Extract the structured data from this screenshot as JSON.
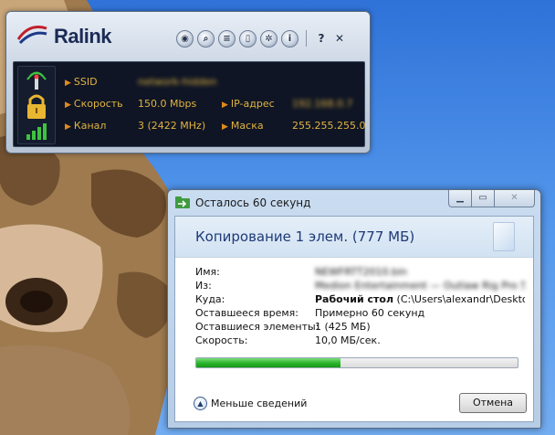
{
  "ralink": {
    "logo_text": "Ralink",
    "toolbar": {
      "icons": [
        "rss-icon",
        "search-icon",
        "list-icon",
        "page-icon",
        "gear-icon",
        "info-icon"
      ],
      "help_label": "?",
      "close_label": "✕"
    },
    "ssid_label": "SSID",
    "ssid_value": "network-hidden",
    "speed_label": "Скорость",
    "speed_value": "150.0 Mbps",
    "channel_label": "Канал",
    "channel_value": "3 (2422 MHz)",
    "ip_label": "IP-адрес",
    "ip_value": "192.168.0.7",
    "mask_label": "Маска",
    "mask_value": "255.255.255.0"
  },
  "copy_dialog": {
    "title": "Осталось 60 секунд",
    "header": "Копирование 1 элем. (777 МБ)",
    "labels": {
      "name": "Имя:",
      "from": "Из:",
      "to": "Куда:",
      "time_left": "Оставшееся время:",
      "items_left": "Оставшиеся элементы:",
      "speed": "Скорость:"
    },
    "values": {
      "name": "NEWFRTT2010.bin",
      "from": "Medion Entertainment — Outlaw Rig Pro 5.12",
      "to_bold": "Рабочий стол",
      "to_path": "(C:\\Users\\alexandr\\Desktop",
      "time_left": "Примерно 60 секунд",
      "items_left": "1 (425 МБ)",
      "speed": "10,0 МБ/сек."
    },
    "progress_percent": 45,
    "fewer_details": "Меньше сведений",
    "cancel": "Отмена"
  }
}
